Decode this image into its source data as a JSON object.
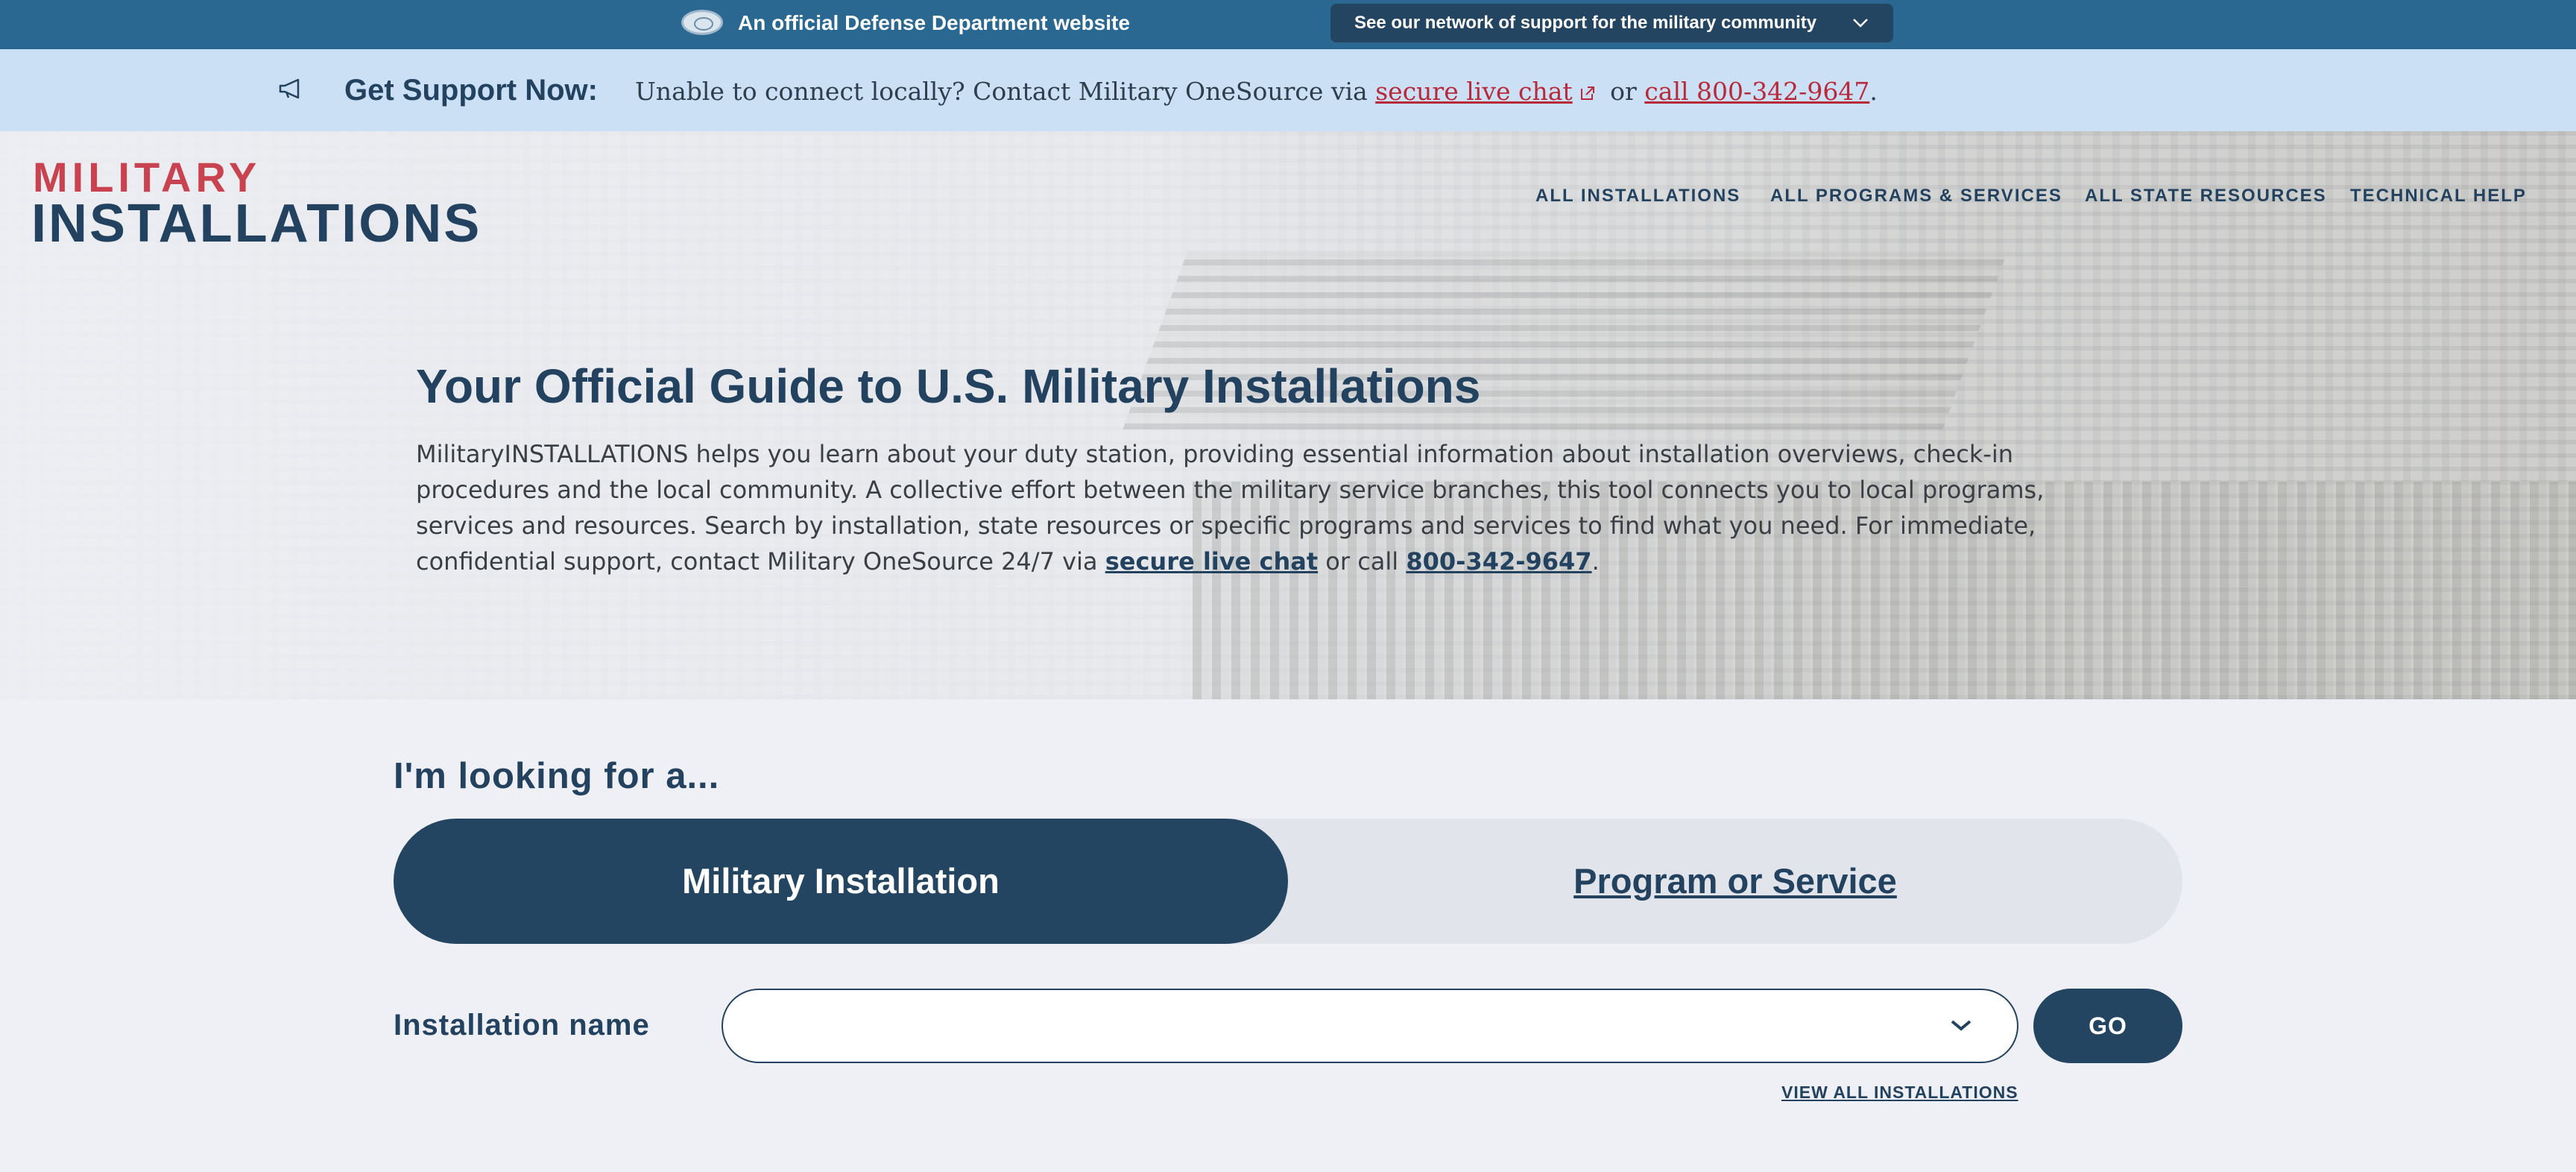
{
  "top_banner": {
    "official_text": "An official Defense Department website",
    "network_button_label": "See our network of support for the military community"
  },
  "support_bar": {
    "title": "Get Support Now:",
    "text_before": "Unable to connect locally? Contact Military OneSource via ",
    "chat_link": "secure live chat",
    "text_middle": " or ",
    "call_link": "call 800-342-9647",
    "text_after": "."
  },
  "logo": {
    "top": "MILITARY",
    "bottom": "INSTALLATIONS"
  },
  "nav": {
    "items": [
      "ALL INSTALLATIONS",
      "ALL PROGRAMS & SERVICES",
      "ALL STATE RESOURCES",
      "TECHNICAL HELP"
    ]
  },
  "hero": {
    "title": "Your Official Guide to U.S. Military Installations",
    "description": "MilitaryINSTALLATIONS helps you learn about your duty station, providing essential information about installation overviews, check-in procedures and the local community. A collective effort between the military service branches, this tool connects you to local programs, services and resources. Search by installation, state resources or specific programs and services to find what you need. For immediate, confidential support, contact Military OneSource 24/7 via ",
    "chat_link": "secure live chat",
    "or_call": " or call ",
    "phone_link": "800-342-9647",
    "end": "."
  },
  "search": {
    "heading": "I'm looking for a...",
    "toggle_active": "Military Installation",
    "toggle_other": "Program or Service",
    "field_label": "Installation name",
    "field_value": "",
    "go_label": "GO",
    "view_all": "VIEW ALL INSTALLATIONS"
  },
  "colors": {
    "banner": "#2a6791",
    "support_bar": "#cce0f5",
    "navy": "#23425f",
    "logo_red": "#c9424f",
    "link_red": "#b8293a"
  }
}
